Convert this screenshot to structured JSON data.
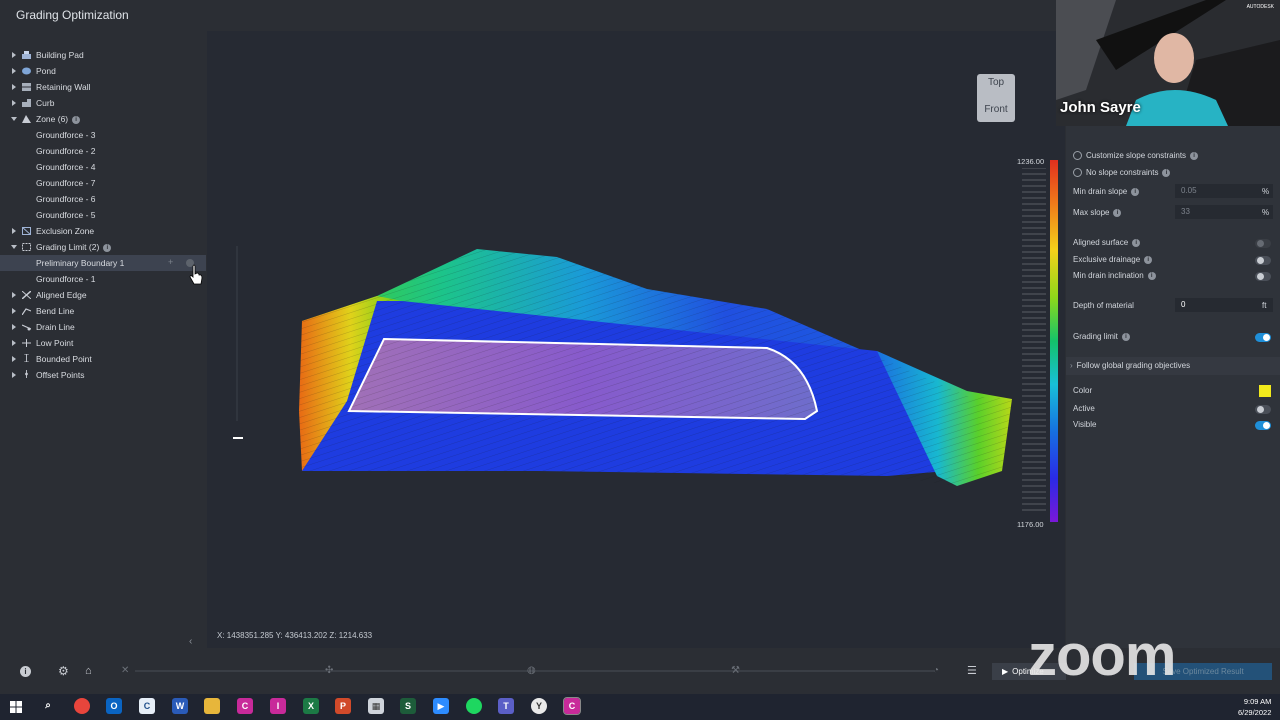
{
  "app": {
    "title": "Grading Optimization"
  },
  "tree": {
    "items": [
      {
        "label": "Building Pad"
      },
      {
        "label": "Pond"
      },
      {
        "label": "Retaining Wall"
      },
      {
        "label": "Curb"
      },
      {
        "label": "Zone (6)"
      },
      {
        "label": "Groundforce - 3"
      },
      {
        "label": "Groundforce - 2"
      },
      {
        "label": "Groundforce - 4"
      },
      {
        "label": "Groundforce - 7"
      },
      {
        "label": "Groundforce - 6"
      },
      {
        "label": "Groundforce - 5"
      },
      {
        "label": "Exclusion Zone"
      },
      {
        "label": "Grading Limit (2)"
      },
      {
        "label": "Preliminary Boundary 1"
      },
      {
        "label": "Groundforce - 1"
      },
      {
        "label": "Aligned Edge"
      },
      {
        "label": "Bend Line"
      },
      {
        "label": "Drain Line"
      },
      {
        "label": "Low Point"
      },
      {
        "label": "Bounded Point"
      },
      {
        "label": "Offset Points"
      }
    ]
  },
  "viewcube": {
    "top": "Top",
    "front": "Front"
  },
  "status": {
    "coords": "X: 1438351.285    Y: 436413.202    Z: 1214.633"
  },
  "legend": {
    "max": "1236.00",
    "min": "1176.00",
    "colors": [
      "#e0301e",
      "#f07a1a",
      "#f4d21a",
      "#8ed81a",
      "#14c26a",
      "#18c0d8",
      "#1670e0",
      "#2a2ae8",
      "#7a18d8"
    ]
  },
  "panel": {
    "customize": "Customize slope constraints",
    "no_slope": "No slope constraints",
    "min_drain": {
      "label": "Min drain slope",
      "value": "0.05",
      "unit": "%"
    },
    "max_slope": {
      "label": "Max slope",
      "value": "33",
      "unit": "%"
    },
    "aligned_surface": "Aligned surface",
    "exclusive_drainage": "Exclusive drainage",
    "min_drain_incl": "Min drain inclination",
    "depth": {
      "label": "Depth of material",
      "value": "0",
      "unit": "ft"
    },
    "grading_limit": "Grading limit",
    "follow": "Follow global grading objectives",
    "color": {
      "label": "Color",
      "value": "#f2ea1c"
    },
    "active": "Active",
    "visible": "Visible"
  },
  "webcam": {
    "name": "John Sayre",
    "brand": "AUTODESK"
  },
  "toolbar": {
    "optimize": "Optimize",
    "publish": "Save Optimized Result"
  },
  "overlay": {
    "zoom": "zoom"
  },
  "taskbar": {
    "time": "9:09 AM",
    "date": "6/29/2022"
  }
}
